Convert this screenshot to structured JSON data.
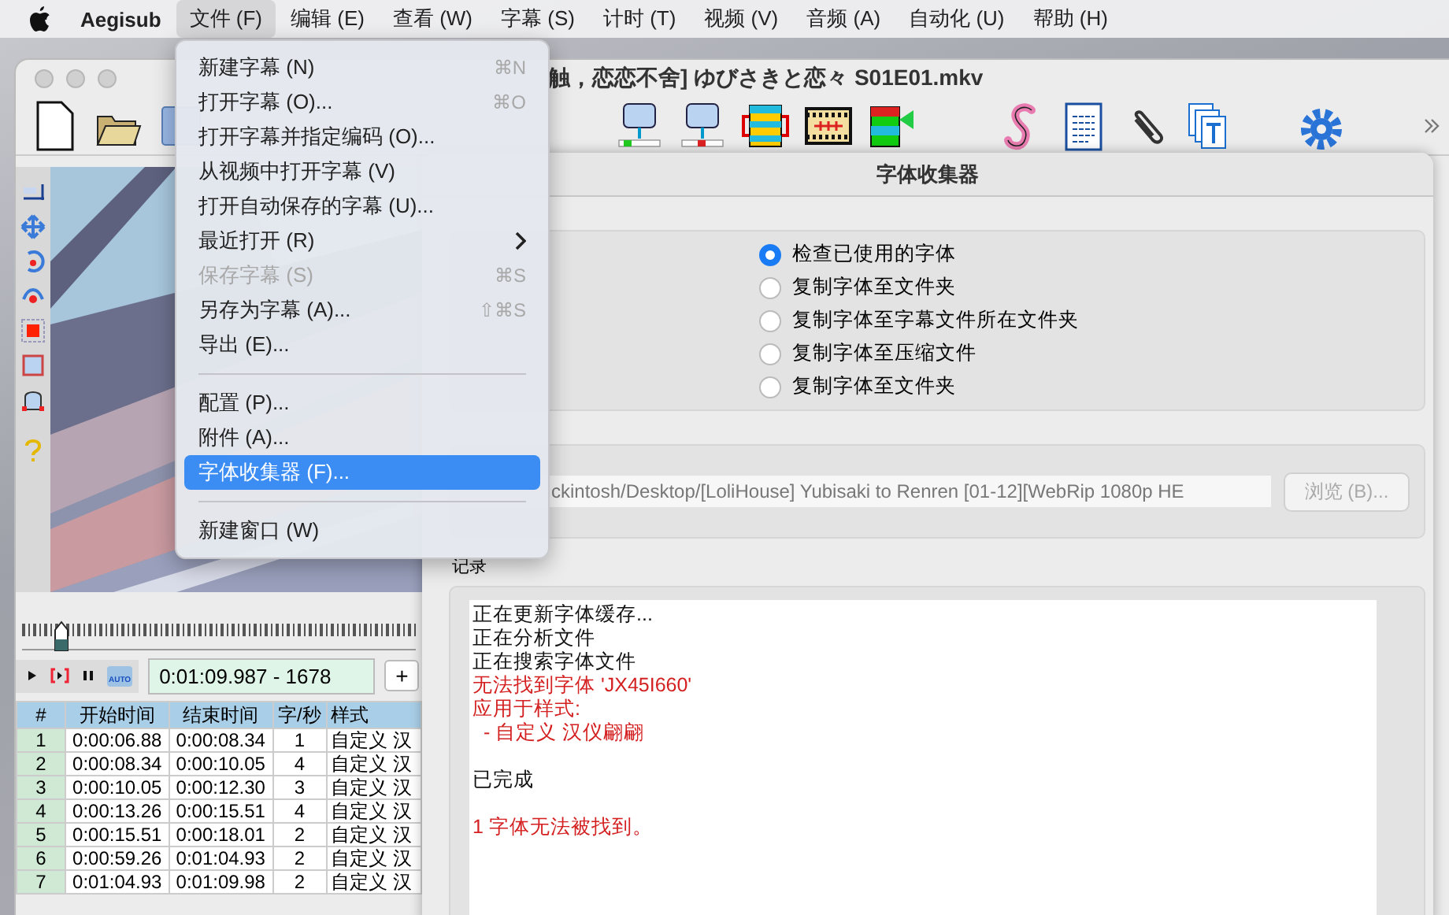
{
  "menu_bar": {
    "app_name": "Aegisub",
    "menus": [
      {
        "label": "文件 (F)",
        "selected": true
      },
      {
        "label": "编辑 (E)",
        "selected": false
      },
      {
        "label": "查看 (W)",
        "selected": false
      },
      {
        "label": "字幕 (S)",
        "selected": false
      },
      {
        "label": "计时 (T)",
        "selected": false
      },
      {
        "label": "视频 (V)",
        "selected": false
      },
      {
        "label": "音频 (A)",
        "selected": false
      },
      {
        "label": "自动化 (U)",
        "selected": false
      },
      {
        "label": "帮助 (H)",
        "selected": false
      }
    ]
  },
  "main_window": {
    "title": "触，恋恋不舍] ゆびさきと恋々 S01E01.mkv",
    "auto_label": "AUTO",
    "time_display": "0:01:09.987 - 1678",
    "add_button": "+",
    "grid": {
      "columns": [
        "#",
        "开始时间",
        "结束时间",
        "字/秒",
        "样式"
      ],
      "rows": [
        [
          "1",
          "0:00:06.88",
          "0:00:08.34",
          "1",
          "自定义 汉"
        ],
        [
          "2",
          "0:00:08.34",
          "0:00:10.05",
          "4",
          "自定义 汉"
        ],
        [
          "3",
          "0:00:10.05",
          "0:00:12.30",
          "3",
          "自定义 汉"
        ],
        [
          "4",
          "0:00:13.26",
          "0:00:15.51",
          "4",
          "自定义 汉"
        ],
        [
          "5",
          "0:00:15.51",
          "0:00:18.01",
          "2",
          "自定义 汉"
        ],
        [
          "6",
          "0:00:59.26",
          "0:01:04.93",
          "2",
          "自定义 汉"
        ],
        [
          "7",
          "0:01:04.93",
          "0:01:09.98",
          "2",
          "自定义 汉"
        ]
      ]
    }
  },
  "dialog": {
    "title": "字体收集器",
    "actions": [
      {
        "label": "检查已使用的字体",
        "selected": true
      },
      {
        "label": "复制字体至文件夹",
        "selected": false
      },
      {
        "label": "复制字体至字幕文件所在文件夹",
        "selected": false
      },
      {
        "label": "复制字体至压缩文件",
        "selected": false
      },
      {
        "label": "复制字体至文件夹",
        "selected": false
      }
    ],
    "path": {
      "value": "ckintosh/Desktop/[LoliHouse] Yubisaki to Renren [01-12][WebRip 1080p HE",
      "disabled": true
    },
    "browse_button": {
      "label": "浏览 (B)...",
      "disabled": true
    },
    "log_label": "记录",
    "log": [
      [
        {
          "text": "正在更新字体缓存...",
          "kind": "info"
        },
        {
          "text": "正在分析文件",
          "kind": "info"
        },
        {
          "text": "正在搜索字体文件",
          "kind": "info"
        },
        {
          "text": "无法找到字体 'JX45I660'",
          "kind": "error"
        },
        {
          "text": "应用于样式:",
          "kind": "error"
        },
        {
          "text": "  - 自定义 汉仪翩翩",
          "kind": "error"
        }
      ],
      [
        {
          "text": "已完成",
          "kind": "info"
        }
      ],
      [
        {
          "text": "1 字体无法被找到。",
          "kind": "error"
        }
      ]
    ]
  },
  "file_menu": {
    "items": [
      {
        "kind": "item",
        "label": "新建字幕 (N)",
        "shortcut": "⌘N",
        "disabled": false,
        "selected": false
      },
      {
        "kind": "item",
        "label": "打开字幕 (O)...",
        "shortcut": "⌘O",
        "disabled": false,
        "selected": false
      },
      {
        "kind": "item",
        "label": "打开字幕并指定编码 (O)...",
        "disabled": false,
        "selected": false
      },
      {
        "kind": "item",
        "label": "从视频中打开字幕 (V)",
        "disabled": false,
        "selected": false
      },
      {
        "kind": "item",
        "label": "打开自动保存的字幕 (U)...",
        "disabled": false,
        "selected": false
      },
      {
        "kind": "submenu",
        "label": "最近打开 (R)",
        "disabled": false,
        "selected": false
      },
      {
        "kind": "item",
        "label": "保存字幕 (S)",
        "shortcut": "⌘S",
        "disabled": true,
        "selected": false
      },
      {
        "kind": "item",
        "label": "另存为字幕 (A)...",
        "shortcut": "⇧⌘S",
        "disabled": false,
        "selected": false
      },
      {
        "kind": "item",
        "label": "导出 (E)...",
        "disabled": false,
        "selected": false
      },
      {
        "kind": "separator"
      },
      {
        "kind": "item",
        "label": "配置 (P)...",
        "disabled": false,
        "selected": false
      },
      {
        "kind": "item",
        "label": "附件 (A)...",
        "disabled": false,
        "selected": false
      },
      {
        "kind": "item",
        "label": "字体收集器 (F)...",
        "disabled": false,
        "selected": true
      },
      {
        "kind": "separator"
      },
      {
        "kind": "item",
        "label": "新建窗口 (W)",
        "disabled": false,
        "selected": false
      }
    ]
  }
}
